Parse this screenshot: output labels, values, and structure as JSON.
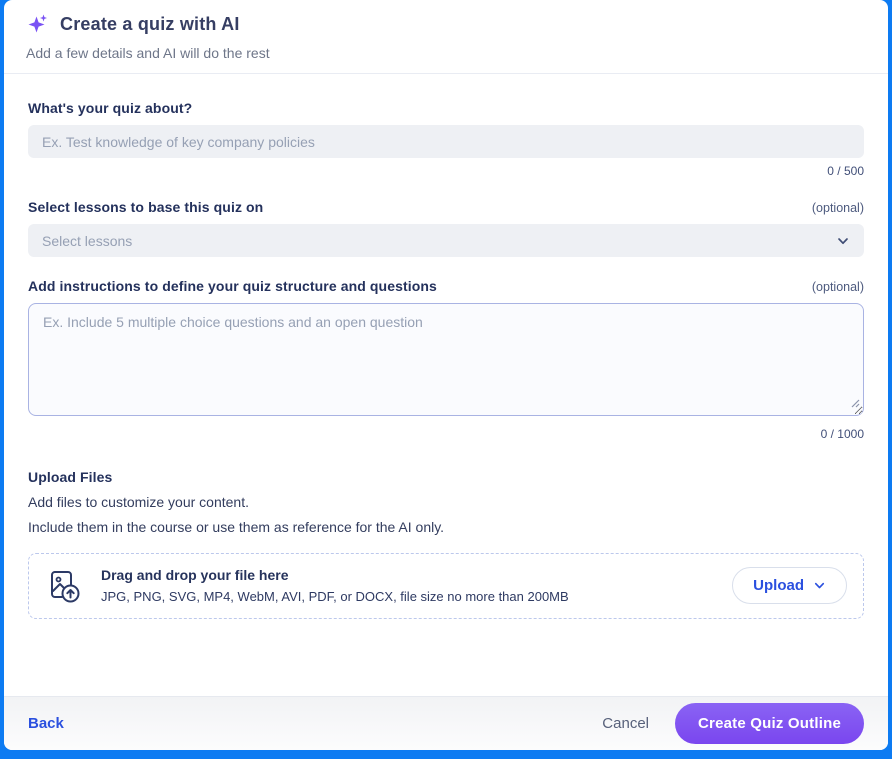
{
  "header": {
    "title": "Create a quiz with AI",
    "subtitle": "Add a few details and AI will do the rest"
  },
  "form": {
    "about": {
      "label": "What's your quiz about?",
      "placeholder": "Ex. Test knowledge of key company policies",
      "value": "",
      "counter": "0 / 500"
    },
    "lessons": {
      "label": "Select lessons to base this quiz on",
      "optional": "(optional)",
      "placeholder": "Select lessons"
    },
    "instructions": {
      "label": "Add instructions to define your quiz structure and questions",
      "optional": "(optional)",
      "placeholder": "Ex. Include 5 multiple choice questions and an open question",
      "value": "",
      "counter": "0 / 1000"
    },
    "upload": {
      "heading": "Upload Files",
      "description_line1": "Add files to customize your content.",
      "description_line2": "Include them in the course or use them as reference for the AI only.",
      "dropzone_title": "Drag and drop your file here",
      "dropzone_hint": "JPG, PNG, SVG, MP4, WebM, AVI, PDF, or DOCX, file size no more than 200MB",
      "upload_button_label": "Upload"
    }
  },
  "footer": {
    "back_label": "Back",
    "cancel_label": "Cancel",
    "submit_label": "Create Quiz Outline"
  },
  "colors": {
    "accent_purple": "#7a52f4",
    "accent_blue": "#2b50df",
    "frame_blue": "#0d7bf2",
    "label_navy": "#24315c"
  }
}
